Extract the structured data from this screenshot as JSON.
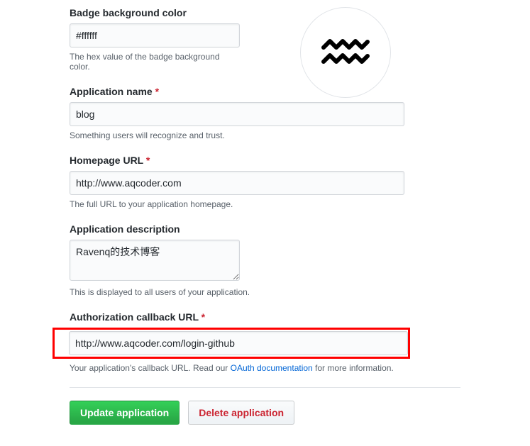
{
  "badge": {
    "label": "Badge background color",
    "value": "#ffffff",
    "help": "The hex value of the badge background color."
  },
  "appname": {
    "label": "Application name",
    "required": "*",
    "value": "blog",
    "help": "Something users will recognize and trust."
  },
  "homepage": {
    "label": "Homepage URL",
    "required": "*",
    "value": "http://www.aqcoder.com",
    "help": "The full URL to your application homepage."
  },
  "description": {
    "label": "Application description",
    "value": "Ravenq的技术博客",
    "help": "This is displayed to all users of your application."
  },
  "callback": {
    "label": "Authorization callback URL",
    "required": "*",
    "value": "http://www.aqcoder.com/login-github",
    "help_before": "Your application's callback URL. Read our ",
    "help_link": "OAuth documentation",
    "help_after": " for more information."
  },
  "buttons": {
    "update": "Update application",
    "delete": "Delete application"
  },
  "logo": {
    "name": "aquarius-icon"
  }
}
